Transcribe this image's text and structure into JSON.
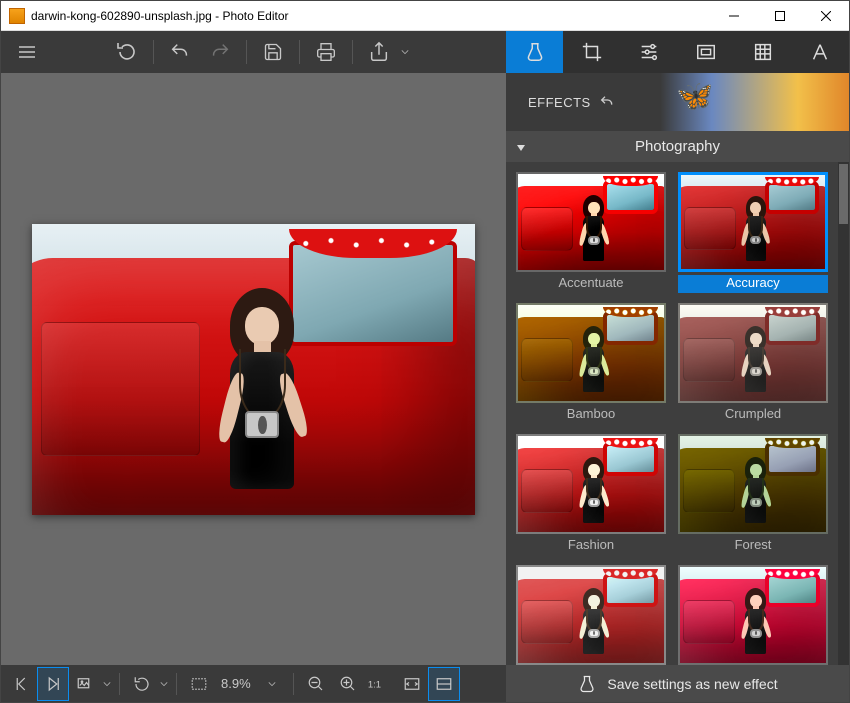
{
  "window": {
    "title": "darwin-kong-602890-unsplash.jpg - Photo Editor",
    "minimize": "Minimize",
    "maximize": "Maximize",
    "close": "Close"
  },
  "toolbar_left": {
    "menu": "menu",
    "undo_big": "undo",
    "undo": "undo-step",
    "redo": "redo-step",
    "save": "save",
    "print": "print",
    "share": "share"
  },
  "right_tabs": {
    "effects": "effects-flask",
    "crop": "crop",
    "adjust": "sliders",
    "vignette": "frame",
    "texture": "grid",
    "text": "text"
  },
  "effects_header": {
    "label": "EFFECTS",
    "reset": "reset"
  },
  "category": {
    "name": "Photography"
  },
  "effects": [
    {
      "label": "Accentuate",
      "selected": false,
      "filter": "flt-accentuate"
    },
    {
      "label": "Accuracy",
      "selected": true,
      "filter": "flt-accuracy"
    },
    {
      "label": "Bamboo",
      "selected": false,
      "filter": "flt-bamboo"
    },
    {
      "label": "Crumpled",
      "selected": false,
      "filter": "flt-crumpled"
    },
    {
      "label": "Fashion",
      "selected": false,
      "filter": "flt-fashion"
    },
    {
      "label": "Forest",
      "selected": false,
      "filter": "flt-forest"
    },
    {
      "label": "",
      "selected": false,
      "filter": "flt-7"
    },
    {
      "label": "",
      "selected": false,
      "filter": "flt-8"
    }
  ],
  "bottombar": {
    "prev": "previous-image",
    "play": "slideshow",
    "gallery": "gallery",
    "rotate": "rotate",
    "fit": "fit-mode",
    "zoom_value": "8.9%",
    "zoom_out": "zoom-out",
    "zoom_in": "zoom-in",
    "actual": "1:1",
    "fitbtn": "fit-window",
    "fill": "fill-window",
    "save_effect": "Save settings as new effect"
  }
}
